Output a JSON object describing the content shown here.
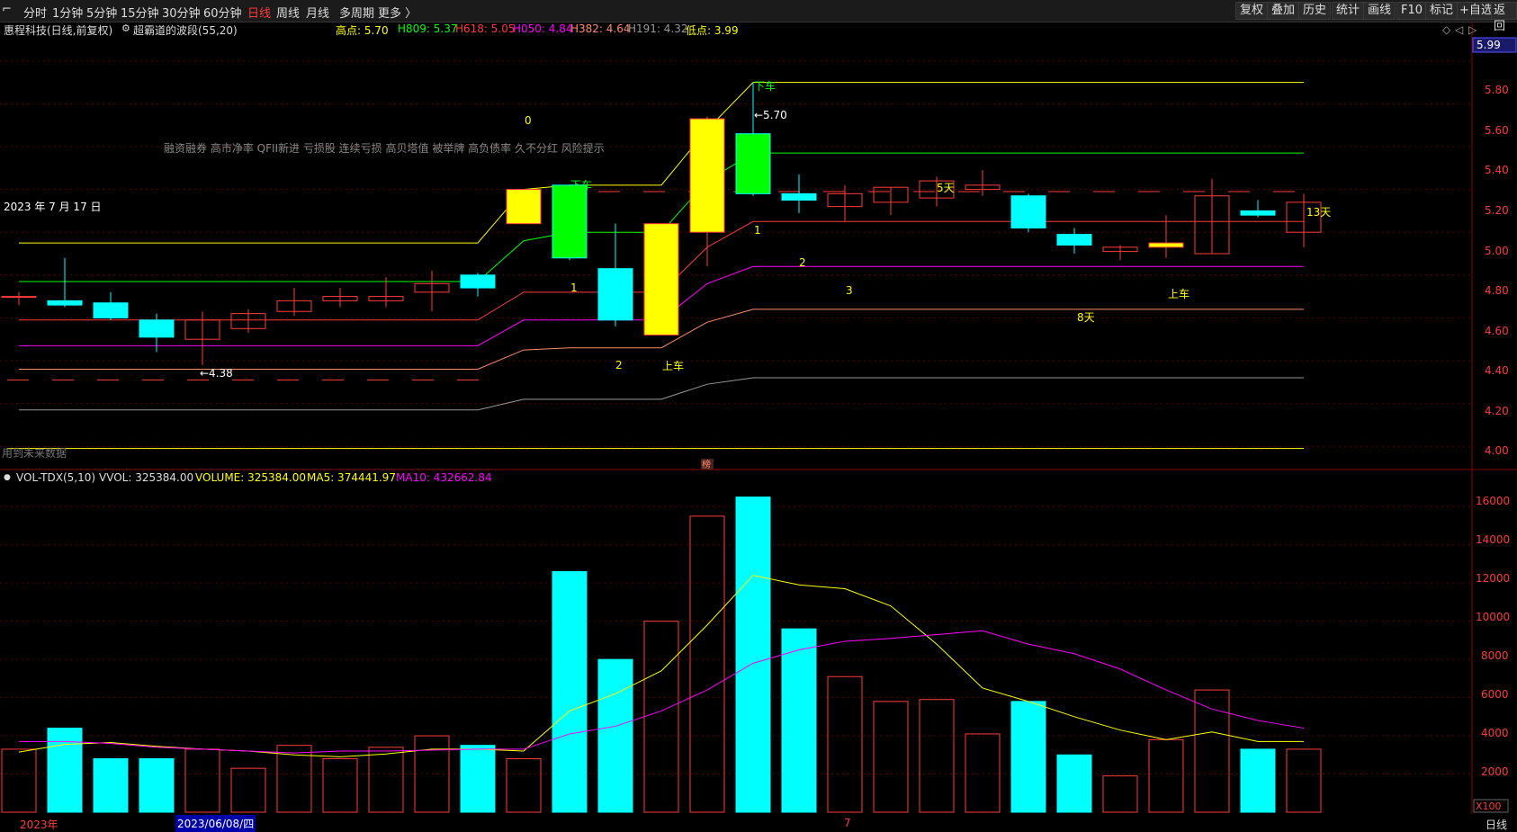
{
  "toolbar": {
    "menu_icon": "⌐",
    "periods": [
      "分时",
      "1分钟",
      "5分钟",
      "15分钟",
      "30分钟",
      "60分钟",
      "日线",
      "周线",
      "月线",
      "多周期",
      "更多 〉"
    ],
    "active_period": "日线",
    "right_buttons": [
      "复权",
      "叠加",
      "历史",
      "统计",
      "画线",
      "F10",
      "标记",
      "+自选",
      "返回"
    ]
  },
  "info": {
    "stock": "惠程科技(日线,前复权)",
    "indicator": "超霸道的波段(55,20)",
    "high_label": "高点: 5.70",
    "h809": "H809: 5.37",
    "h618": "H618: 5.05",
    "h050": "H050: 4.84",
    "h382": "H382: 4.64",
    "h191": "H191: 4.32",
    "low_label": "低点: 3.99",
    "current_price": "5.99"
  },
  "colors": {
    "up": "#ff3b3b",
    "down": "#00ffff",
    "yellow": "#ffff00",
    "green": "#00ff00",
    "magenta": "#ff00ff",
    "salmon": "#ff8c69",
    "gray": "#999999",
    "grid": "#5a0000"
  },
  "annotations": {
    "date_label": "2023 年 7 月 17 日",
    "tags": "融资融券 高市净率 QFII新进 亏损股 连续亏损 高贝塔值 被举牌 高负债率 久不分红 风险提示",
    "low_mark": "←4.38",
    "high_mark": "←5.70",
    "zero_a": "0",
    "zero_b": "0",
    "xiache_a": "下车",
    "xiache_b": "下车",
    "shangche_a": "上车",
    "shangche_b": "上车",
    "n1_a": "1",
    "n1_b": "1",
    "n2_a": "2",
    "n2_b": "2",
    "n3": "3",
    "days5": "5天",
    "days8": "8天",
    "days13": "13天",
    "future_note": "用到未来数据",
    "bang": "榜"
  },
  "price_axis": {
    "ticks": [
      "5.80",
      "5.60",
      "5.40",
      "5.20",
      "5.00",
      "4.80",
      "4.60",
      "4.40",
      "4.20",
      "4.00"
    ]
  },
  "volume": {
    "title": "VOL-TDX(5,10)",
    "vvol": "VVOL: 325384.00",
    "volume_label": "VOLUME: 325384.00",
    "ma5": "MA5: 374441.97",
    "ma10": "MA10: 432662.84",
    "ticks": [
      "16000",
      "14000",
      "12000",
      "10000",
      "8000",
      "6000",
      "4000",
      "2000"
    ],
    "unit": "X100"
  },
  "bottom": {
    "year": "2023年",
    "cursor_date": "2023/06/08/四",
    "month": "7",
    "period": "日线"
  },
  "chart_data": {
    "type": "candlestick",
    "candles": [
      {
        "o": 4.7,
        "c": 4.7,
        "h": 4.72,
        "l": 4.66,
        "v": 3300
      },
      {
        "o": 4.68,
        "c": 4.66,
        "h": 4.88,
        "l": 4.65,
        "v": 4400
      },
      {
        "o": 4.67,
        "c": 4.6,
        "h": 4.72,
        "l": 4.59,
        "v": 2800
      },
      {
        "o": 4.59,
        "c": 4.51,
        "h": 4.62,
        "l": 4.44,
        "v": 2800
      },
      {
        "o": 4.5,
        "c": 4.59,
        "h": 4.63,
        "l": 4.38,
        "v": 3300
      },
      {
        "o": 4.55,
        "c": 4.62,
        "h": 4.64,
        "l": 4.53,
        "v": 2300
      },
      {
        "o": 4.63,
        "c": 4.68,
        "h": 4.74,
        "l": 4.61,
        "v": 3500
      },
      {
        "o": 4.68,
        "c": 4.7,
        "h": 4.74,
        "l": 4.65,
        "v": 2800
      },
      {
        "o": 4.68,
        "c": 4.7,
        "h": 4.79,
        "l": 4.65,
        "v": 3400
      },
      {
        "o": 4.72,
        "c": 4.76,
        "h": 4.82,
        "l": 4.63,
        "v": 4000
      },
      {
        "o": 4.8,
        "c": 4.74,
        "h": 4.81,
        "l": 4.7,
        "v": 3500
      },
      {
        "o": 5.04,
        "c": 5.2,
        "h": 5.2,
        "l": 5.04,
        "v": 2800
      },
      {
        "o": 5.22,
        "c": 4.88,
        "h": 5.22,
        "l": 4.87,
        "v": 12600
      },
      {
        "o": 4.83,
        "c": 4.59,
        "h": 5.04,
        "l": 4.56,
        "v": 8000
      },
      {
        "o": 4.52,
        "c": 5.04,
        "h": 5.04,
        "l": 4.52,
        "v": 10000
      },
      {
        "o": 5.0,
        "c": 5.53,
        "h": 5.54,
        "l": 4.84,
        "v": 15500
      },
      {
        "o": 5.46,
        "c": 5.18,
        "h": 5.7,
        "l": 5.17,
        "v": 16500
      },
      {
        "o": 5.18,
        "c": 5.15,
        "h": 5.27,
        "l": 5.09,
        "v": 9600
      },
      {
        "o": 5.12,
        "c": 5.18,
        "h": 5.22,
        "l": 5.05,
        "v": 7100
      },
      {
        "o": 5.14,
        "c": 5.21,
        "h": 5.21,
        "l": 5.08,
        "v": 5800
      },
      {
        "o": 5.16,
        "c": 5.24,
        "h": 5.26,
        "l": 5.12,
        "v": 5900
      },
      {
        "o": 5.2,
        "c": 5.22,
        "h": 5.29,
        "l": 5.17,
        "v": 4100
      },
      {
        "o": 5.17,
        "c": 5.02,
        "h": 5.18,
        "l": 5.0,
        "v": 5800
      },
      {
        "o": 4.99,
        "c": 4.94,
        "h": 5.02,
        "l": 4.9,
        "v": 3000
      },
      {
        "o": 4.91,
        "c": 4.93,
        "h": 4.94,
        "l": 4.87,
        "v": 1900
      },
      {
        "o": 4.93,
        "c": 4.95,
        "h": 5.08,
        "l": 4.88,
        "v": 3800
      },
      {
        "o": 4.9,
        "c": 5.17,
        "h": 5.25,
        "l": 4.9,
        "v": 6400
      },
      {
        "o": 5.1,
        "c": 5.08,
        "h": 5.15,
        "l": 5.07,
        "v": 3300
      },
      {
        "o": 5.0,
        "c": 5.14,
        "h": 5.18,
        "l": 4.93,
        "v": 3300
      }
    ],
    "yellow_line": [
      4.95,
      4.95,
      4.95,
      4.95,
      4.95,
      4.95,
      4.95,
      4.95,
      4.95,
      4.95,
      4.95,
      5.2,
      5.22,
      5.22,
      5.22,
      5.48,
      5.7,
      5.7,
      5.7,
      5.7,
      5.7,
      5.7,
      5.7,
      5.7,
      5.7,
      5.7,
      5.7,
      5.7,
      5.7,
      5.7
    ],
    "green_line": [
      4.77,
      4.77,
      4.77,
      4.77,
      4.77,
      4.77,
      4.77,
      4.77,
      4.77,
      4.77,
      4.77,
      4.96,
      5.0,
      5.0,
      5.0,
      5.24,
      5.37,
      5.37,
      5.37,
      5.37,
      5.37,
      5.37,
      5.37,
      5.37,
      5.37,
      5.37,
      5.37,
      5.37,
      5.37,
      5.37
    ],
    "red_line": [
      4.59,
      4.59,
      4.59,
      4.59,
      4.59,
      4.59,
      4.59,
      4.59,
      4.59,
      4.59,
      4.59,
      4.72,
      4.72,
      4.72,
      4.72,
      4.93,
      5.05,
      5.05,
      5.05,
      5.05,
      5.05,
      5.05,
      5.05,
      5.05,
      5.05,
      5.05,
      5.05,
      5.05,
      5.05,
      5.05
    ],
    "magenta_line": [
      4.47,
      4.47,
      4.47,
      4.47,
      4.47,
      4.47,
      4.47,
      4.47,
      4.47,
      4.47,
      4.47,
      4.59,
      4.59,
      4.59,
      4.59,
      4.76,
      4.84,
      4.84,
      4.84,
      4.84,
      4.84,
      4.84,
      4.84,
      4.84,
      4.84,
      4.84,
      4.84,
      4.84,
      4.84,
      4.84
    ],
    "salmon_line": [
      4.36,
      4.36,
      4.36,
      4.36,
      4.36,
      4.36,
      4.36,
      4.36,
      4.36,
      4.36,
      4.36,
      4.45,
      4.46,
      4.46,
      4.46,
      4.58,
      4.64,
      4.64,
      4.64,
      4.64,
      4.64,
      4.64,
      4.64,
      4.64,
      4.64,
      4.64,
      4.64,
      4.64,
      4.64,
      4.64
    ],
    "gray_line": [
      4.17,
      4.17,
      4.17,
      4.17,
      4.17,
      4.17,
      4.17,
      4.17,
      4.17,
      4.17,
      4.17,
      4.22,
      4.22,
      4.22,
      4.22,
      4.29,
      4.32,
      4.32,
      4.32,
      4.32,
      4.32,
      4.32,
      4.32,
      4.32,
      4.32,
      4.32,
      4.32,
      4.32,
      4.32,
      4.32
    ],
    "dashed_red_left": 4.31,
    "dashed_red_right": 5.19,
    "low_line": 3.99,
    "ma5": [
      3150,
      3550,
      3650,
      3450,
      3300,
      3200,
      3000,
      2900,
      3050,
      3300,
      3300,
      3200,
      5300,
      6200,
      7400,
      9800,
      12400,
      11900,
      11700,
      10800,
      8800,
      6500,
      5800,
      5000,
      4300,
      3800,
      4200,
      3700,
      3700
    ],
    "ma10": [
      3700,
      3700,
      3600,
      3400,
      3300,
      3200,
      3100,
      3200,
      3200,
      3250,
      3300,
      3300,
      4100,
      4500,
      5300,
      6400,
      7800,
      8500,
      8950,
      9100,
      9300,
      9500,
      8800,
      8300,
      7500,
      6400,
      5400,
      4800,
      4400
    ],
    "price_range": [
      3.9,
      5.9
    ],
    "volume_range": [
      0,
      17000
    ]
  }
}
